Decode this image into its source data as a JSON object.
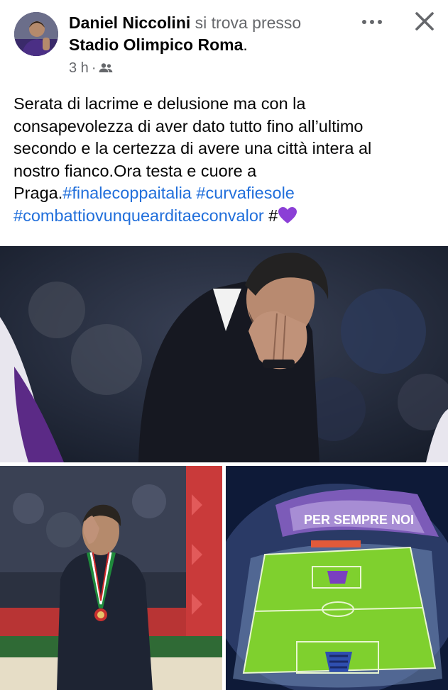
{
  "post": {
    "author": "Daniel Niccolini",
    "verb": "si trova presso",
    "location": "Stadio Olimpico Roma",
    "location_suffix": ".",
    "time": "3 h",
    "separator": "·",
    "audience_icon": "friends-icon",
    "text_lines": [
      "Serata di lacrime e delusione ma con la",
      "consapevolezza di aver dato tutto fino all’ultimo",
      "secondo e la certezza di avere una città intera al",
      "nostro fianco.Ora testa e cuore a"
    ],
    "text_tail": "Praga.",
    "hashtags": [
      "#finalecoppaitalia",
      "#curvafiesole",
      "#combattiovunquearditaeconvalor",
      "#"
    ],
    "heart_emoji": "purple-heart"
  },
  "icons": {
    "more": "more-horizontal-icon",
    "close": "close-icon"
  },
  "images": [
    {
      "name": "coach-praying-photo"
    },
    {
      "name": "coach-medal-photo"
    },
    {
      "name": "stadium-aerial-photo",
      "banner_text": "PER SEMPRE NOI"
    }
  ],
  "colors": {
    "hashtag": "#216fdb",
    "secondary_text": "#65676b",
    "fiorentina_purple": "#5b2a86",
    "heart": "#8b3fd6"
  }
}
